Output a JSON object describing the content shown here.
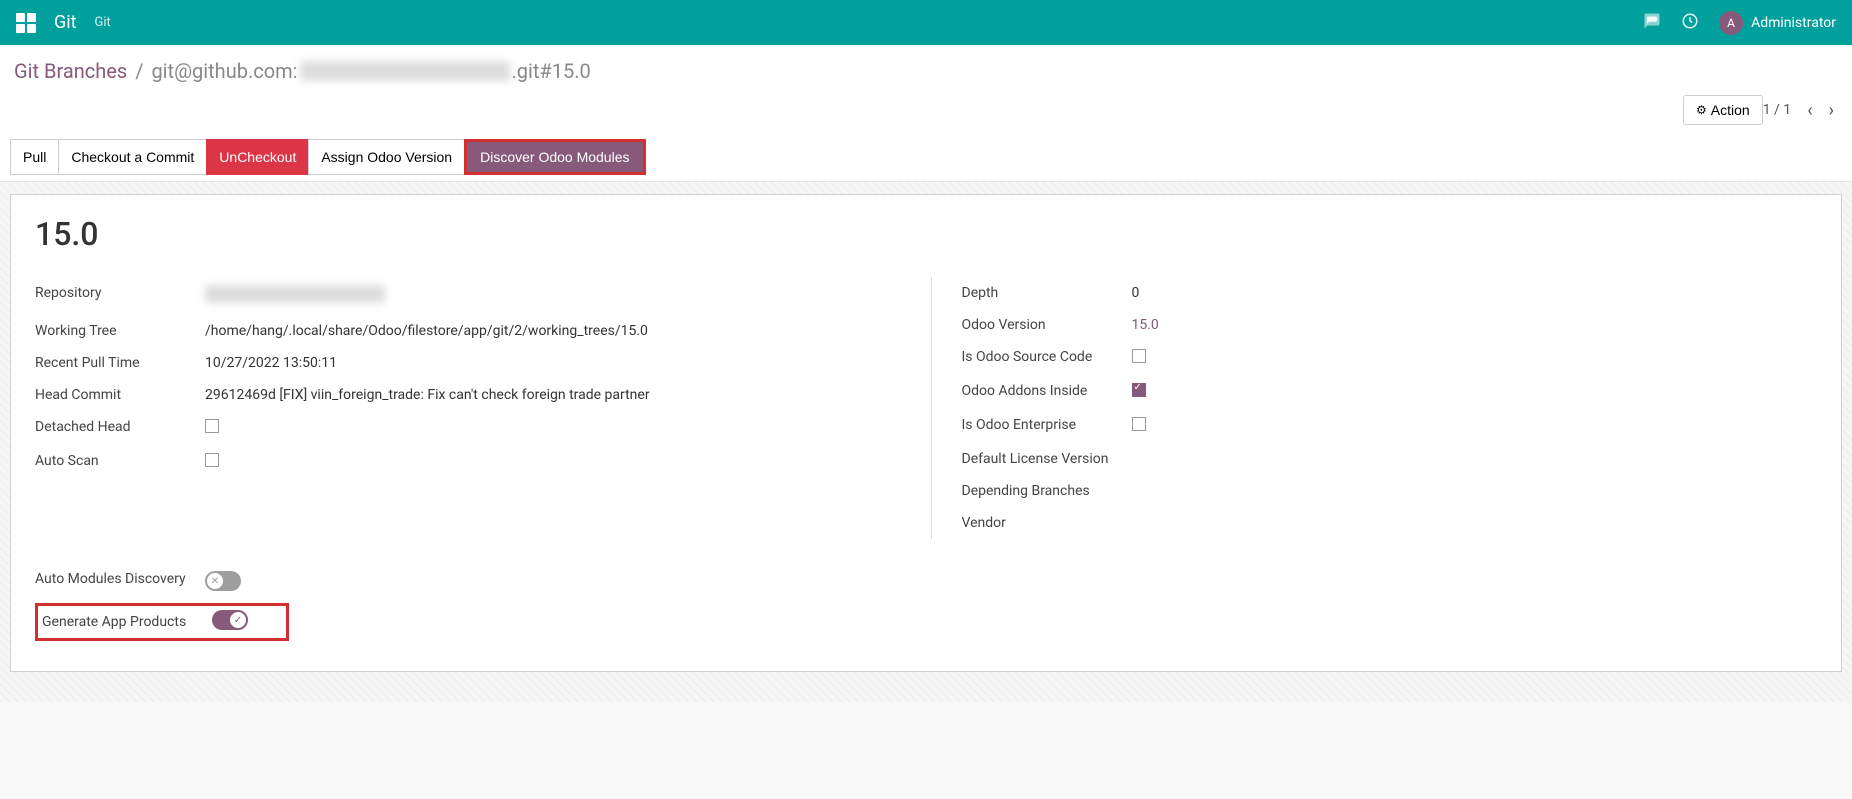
{
  "topbar": {
    "app_title": "Git",
    "app_sub": "Git",
    "user_initial": "A",
    "user_name": "Administrator"
  },
  "breadcrumb": {
    "root": "Git Branches",
    "prefix": "git@github.com:",
    "suffix": ".git#15.0"
  },
  "controls": {
    "action_label": "Action",
    "pager_text": "1 / 1"
  },
  "buttons": {
    "pull": "Pull",
    "checkout_commit": "Checkout a Commit",
    "uncheckout": "UnCheckout",
    "assign_version": "Assign Odoo Version",
    "discover_modules": "Discover Odoo Modules"
  },
  "sheet": {
    "title": "15.0",
    "left": {
      "repository_label": "Repository",
      "working_tree_label": "Working Tree",
      "working_tree_value": "/home/hang/.local/share/Odoo/filestore/app/git/2/working_trees/15.0",
      "recent_pull_label": "Recent Pull Time",
      "recent_pull_value": "10/27/2022 13:50:11",
      "head_commit_label": "Head Commit",
      "head_commit_value": "29612469d [FIX] viin_foreign_trade: Fix can't check foreign trade partner",
      "detached_head_label": "Detached Head",
      "auto_scan_label": "Auto Scan"
    },
    "right": {
      "depth_label": "Depth",
      "depth_value": "0",
      "odoo_version_label": "Odoo Version",
      "odoo_version_value": "15.0",
      "is_source_label": "Is Odoo Source Code",
      "addons_inside_label": "Odoo Addons Inside",
      "is_enterprise_label": "Is Odoo Enterprise",
      "default_license_label": "Default License Version",
      "depending_branches_label": "Depending Branches",
      "vendor_label": "Vendor"
    },
    "bottom": {
      "auto_discovery_label": "Auto Modules Discovery",
      "generate_products_label": "Generate App Products"
    }
  }
}
